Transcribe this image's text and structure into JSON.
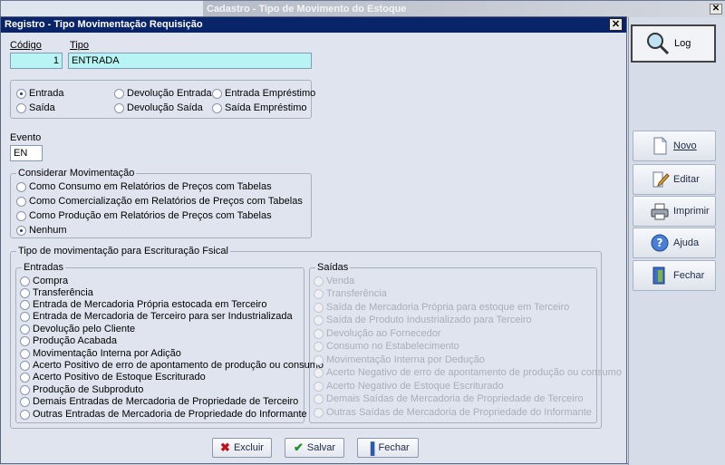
{
  "background_window": {
    "title": "Cadastro - Tipo de Movimento do Estoque",
    "close": "✕"
  },
  "dialog": {
    "title": "Registro - Tipo Movimentação Requisição",
    "close": "✕"
  },
  "fields": {
    "codigo_label": "Código",
    "codigo_value": "1",
    "tipo_label": "Tipo",
    "tipo_value": "ENTRADA",
    "evento_label": "Evento",
    "evento_value": "EN"
  },
  "movement_type": {
    "options": [
      "Entrada",
      "Devolução Entrada",
      "Entrada Empréstimo",
      "Saída",
      "Devolução Saída",
      "Saída Empréstimo"
    ],
    "selected": "Entrada"
  },
  "considerar": {
    "legend": "Considerar Movimentação",
    "options": [
      "Como Consumo em Relatórios de Preços com Tabelas",
      "Como Comercialização em Relatórios de Preços com Tabelas",
      "Como Produção em Relatórios de Preços com Tabelas",
      "Nenhum"
    ],
    "selected": "Nenhum"
  },
  "fiscal": {
    "legend": "Tipo de movimentação para Escrituração Fsical",
    "entradas_legend": "Entradas",
    "entradas": [
      "Compra",
      "Transferência",
      "Entrada de Mercadoria Própria estocada em Terceiro",
      "Entrada de Mercadoria de Terceiro para ser Industrializada",
      "Devolução pelo Cliente",
      "Produção Acabada",
      "Movimentação Interna por Adição",
      "Acerto Positivo de erro de apontamento de produção ou consumo",
      "Acerto Positivo de Estoque Escriturado",
      "Produção de Subproduto",
      "Demais Entradas de Mercadoria de Propriedade de Terceiro",
      "Outras Entradas de Mercadoria de Propriedade do Informante"
    ],
    "saidas_legend": "Saídas",
    "saidas": [
      "Venda",
      "Transferência",
      "Saída de Mercadoria Própria para estoque em Terceiro",
      "Saída de Produto Industrializado para Terceiro",
      "Devolução ao Fornecedor",
      "Consumo no Estabelecimento",
      "Movimentação Interna por Dedução",
      "Acerto Negativo de erro de apontamento de produção ou consumo",
      "Acerto Negativo de Estoque Escriturado",
      "Demais Saídas de Mercadoria de Propriedade de Terceiro",
      "Outras Saídas de Mercadoria de Propriedade do Informante"
    ]
  },
  "buttons": {
    "excluir": "Excluir",
    "salvar": "Salvar",
    "fechar": "Fechar"
  },
  "side_buttons": {
    "log": "Log",
    "novo": "Novo",
    "editar": "Editar",
    "imprimir": "Imprimir",
    "ajuda": "Ajuda",
    "fechar": "Fechar"
  },
  "colors": {
    "title_bar": "#0a246a",
    "input_highlight": "#b9f4f4",
    "background": "#dfe4ee"
  }
}
